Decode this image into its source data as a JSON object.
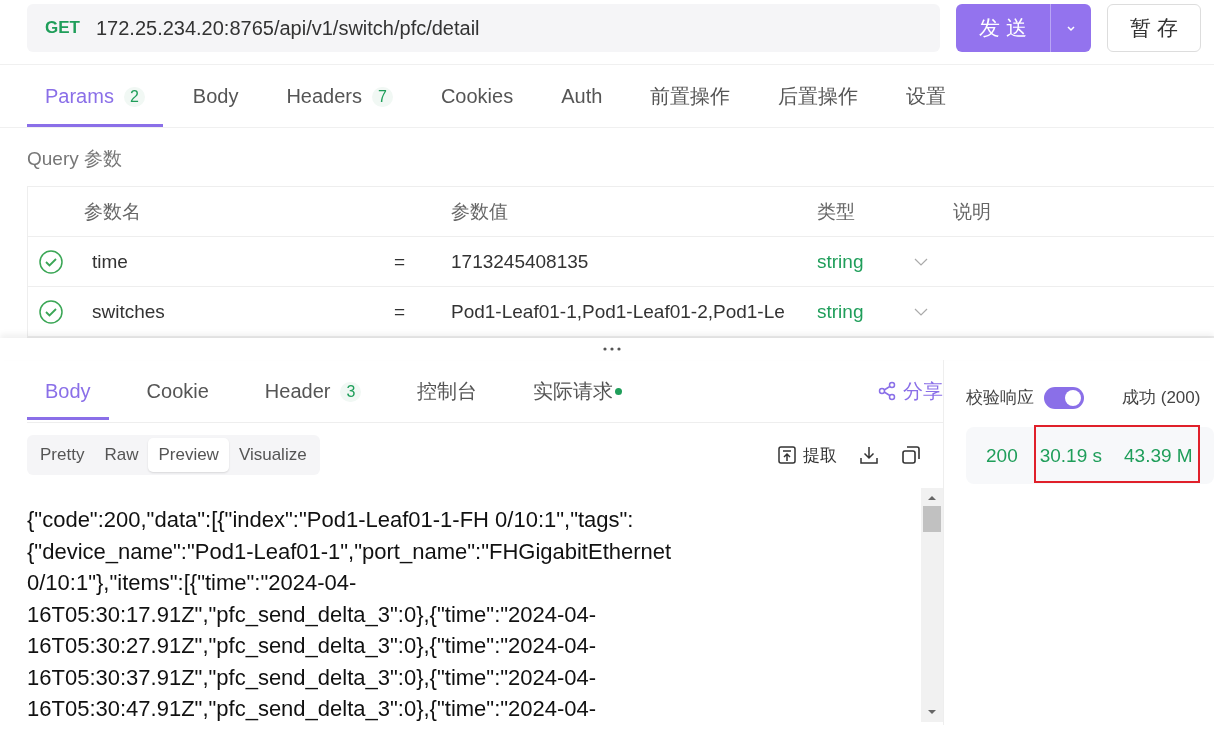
{
  "request": {
    "method": "GET",
    "url": "172.25.234.20:8765/api/v1/switch/pfc/detail",
    "send_label": "发 送",
    "save_label": "暂 存"
  },
  "request_tabs": [
    {
      "label": "Params",
      "count": "2",
      "selected": true
    },
    {
      "label": "Body",
      "selected": false
    },
    {
      "label": "Headers",
      "count": "7",
      "selected": false
    },
    {
      "label": "Cookies",
      "selected": false
    },
    {
      "label": "Auth",
      "selected": false
    },
    {
      "label": "前置操作",
      "selected": false
    },
    {
      "label": "后置操作",
      "selected": false
    },
    {
      "label": "设置",
      "selected": false
    }
  ],
  "query": {
    "title": "Query 参数",
    "columns": [
      "参数名",
      "参数值",
      "类型",
      "说明"
    ],
    "rows": [
      {
        "checked": true,
        "name": "time",
        "eq": "=",
        "value": "1713245408135",
        "type": "string"
      },
      {
        "checked": true,
        "name": "switches",
        "eq": "=",
        "value": "Pod1-Leaf01-1,Pod1-Leaf01-2,Pod1-Le",
        "type": "string"
      }
    ]
  },
  "response_tabs": [
    {
      "label": "Body",
      "selected": true
    },
    {
      "label": "Cookie",
      "selected": false
    },
    {
      "label": "Header",
      "count": "3",
      "selected": false
    },
    {
      "label": "控制台",
      "selected": false
    },
    {
      "label": "实际请求",
      "dot": true,
      "selected": false
    }
  ],
  "share_label": "分享",
  "view_modes": [
    {
      "label": "Pretty",
      "selected": false
    },
    {
      "label": "Raw",
      "selected": false
    },
    {
      "label": "Preview",
      "selected": true
    },
    {
      "label": "Visualize",
      "selected": false
    }
  ],
  "extract_label": "提取",
  "body_lines": [
    "{\"code\":200,\"data\":[{\"index\":\"Pod1-Leaf01-1-FH 0/10:1\",\"tags\":",
    "{\"device_name\":\"Pod1-Leaf01-1\",\"port_name\":\"FHGigabitEthernet",
    "0/10:1\"},\"items\":[{\"time\":\"2024-04-",
    "16T05:30:17.91Z\",\"pfc_send_delta_3\":0},{\"time\":\"2024-04-",
    "16T05:30:27.91Z\",\"pfc_send_delta_3\":0},{\"time\":\"2024-04-",
    "16T05:30:37.91Z\",\"pfc_send_delta_3\":0},{\"time\":\"2024-04-",
    "16T05:30:47.91Z\",\"pfc_send_delta_3\":0},{\"time\":\"2024-04-"
  ],
  "validate": {
    "label": "校验响应",
    "on": true,
    "result": "成功 (200)"
  },
  "stats": {
    "status": "200",
    "time": "30.19 s",
    "size": "43.39 M"
  }
}
